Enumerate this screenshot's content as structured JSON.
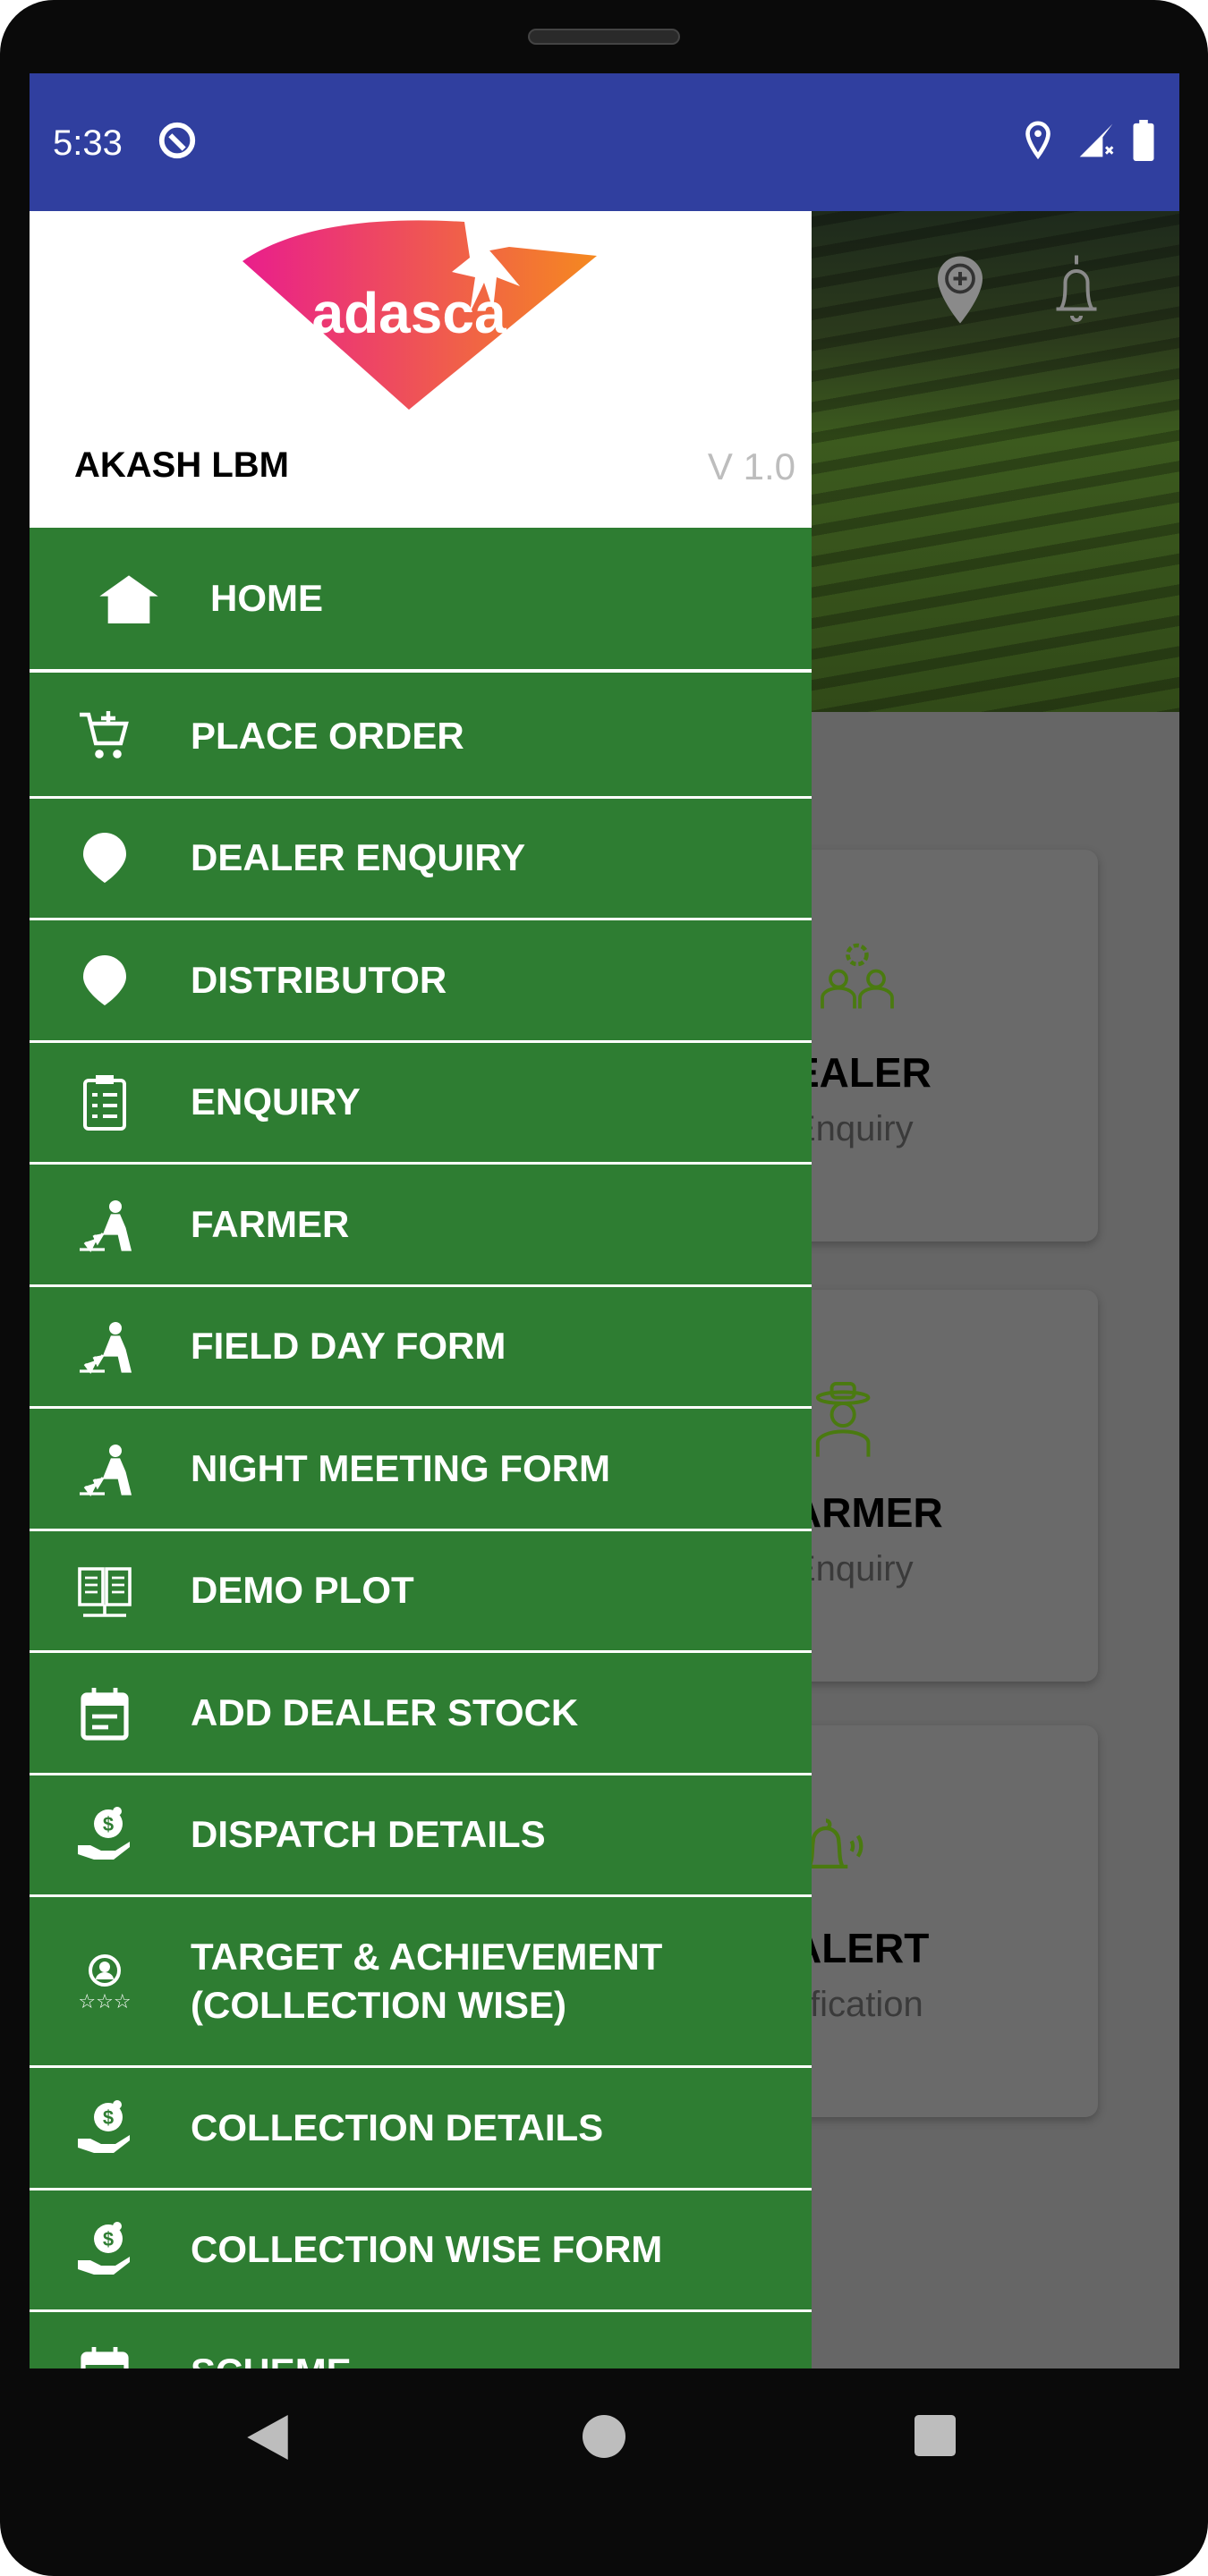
{
  "status_bar": {
    "time": "5:33",
    "icons": [
      "at-sign-icon",
      "location-icon",
      "signal-no-data-icon",
      "battery-icon"
    ]
  },
  "colors": {
    "status_bar": "#303f9f",
    "drawer": "#2e7d32",
    "card_icon": "#4a7a10",
    "logo_start": "#e91e8c",
    "logo_end": "#f5891f"
  },
  "header_icons": [
    "add-location-icon",
    "bell-icon"
  ],
  "cards": [
    {
      "title": "EALER",
      "subtitle": "Enquiry",
      "icon": "dealer-gear-people-icon"
    },
    {
      "title": "ARMER",
      "subtitle": "Enquiry",
      "icon": "farmer-icon"
    },
    {
      "title": "ALERT",
      "subtitle": "tification",
      "icon": "ringing-bell-icon"
    }
  ],
  "drawer": {
    "logo_text": "adasca",
    "user_name": "AKASH LBM",
    "version": "V 1.0",
    "home": {
      "label": "HOME",
      "icon": "home-icon"
    },
    "items": [
      {
        "label": "PLACE ORDER",
        "icon": "add-cart-icon"
      },
      {
        "label": "DEALER ENQUIRY",
        "icon": "pin-icon"
      },
      {
        "label": "DISTRIBUTOR",
        "icon": "pin-icon"
      },
      {
        "label": "ENQUIRY",
        "icon": "clipboard-icon"
      },
      {
        "label": "FARMER",
        "icon": "farmer-planting-icon"
      },
      {
        "label": "FIELD DAY FORM",
        "icon": "farmer-planting-icon"
      },
      {
        "label": "NIGHT MEETING FORM",
        "icon": "farmer-planting-icon"
      },
      {
        "label": "DEMO PLOT",
        "icon": "book-plant-icon"
      },
      {
        "label": "ADD DEALER STOCK",
        "icon": "calendar-icon"
      },
      {
        "label": "DISPATCH DETAILS",
        "icon": "money-hand-icon"
      },
      {
        "label": "TARGET & ACHIEVEMENT\n(COLLECTION WISE)",
        "icon": "user-stars-icon"
      },
      {
        "label": "COLLECTION DETAILS",
        "icon": "money-hand-icon"
      },
      {
        "label": "COLLECTION WISE FORM",
        "icon": "money-hand-icon"
      },
      {
        "label": "SCHEME",
        "icon": "calendar-icon"
      }
    ]
  },
  "nav_bar": {
    "buttons": [
      "back-icon",
      "home-circle-icon",
      "recents-icon"
    ]
  }
}
